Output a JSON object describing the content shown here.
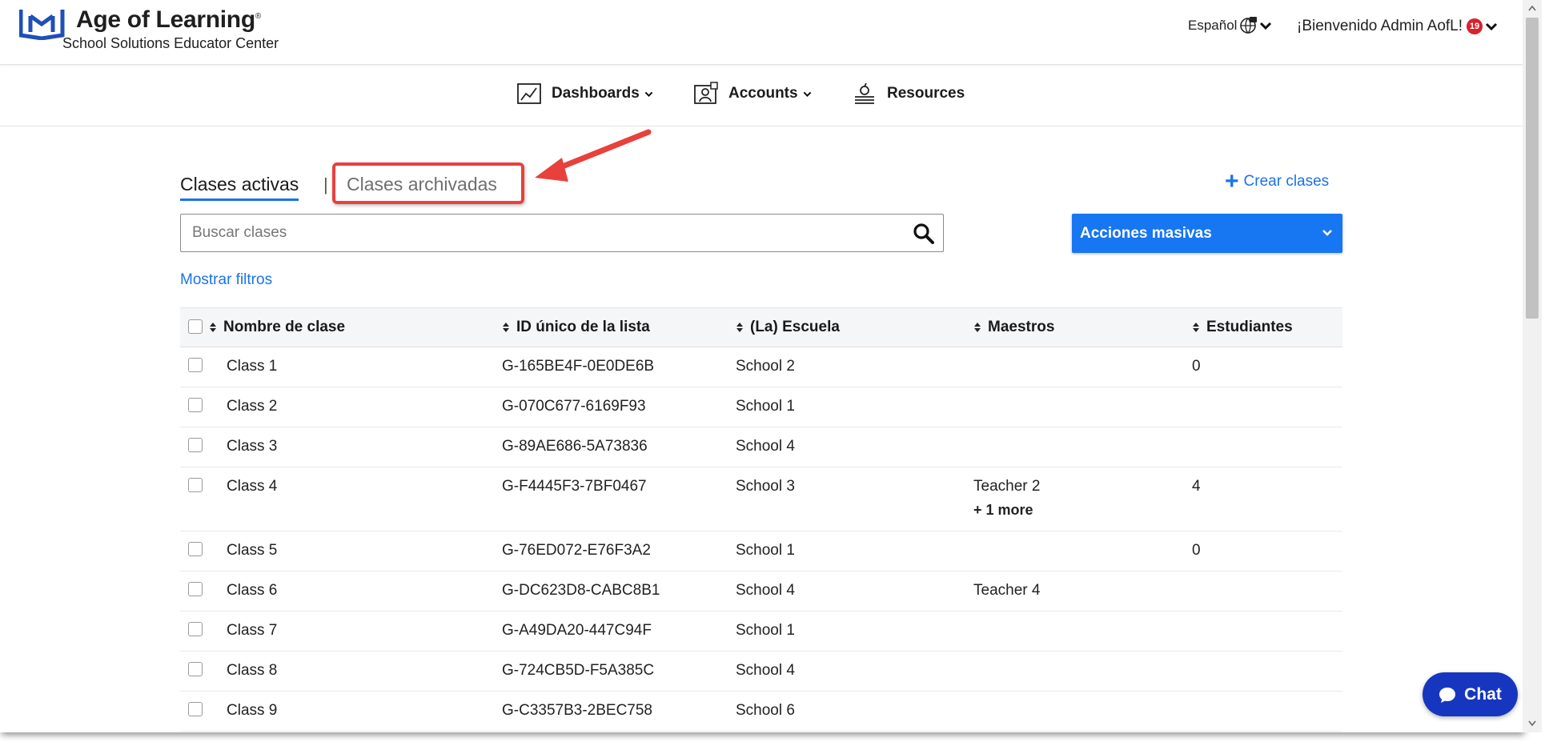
{
  "header": {
    "brand_name": "Age of Learning",
    "brand_reg": "®",
    "brand_subtitle": "School Solutions Educator Center",
    "language": "Español",
    "welcome": "¡Bienvenido Admin AofL!",
    "notification_count": "19"
  },
  "nav": {
    "dashboards": "Dashboards",
    "accounts": "Accounts",
    "resources": "Resources"
  },
  "tabs": {
    "active": "Clases activas",
    "separator": "|",
    "archived": "Clases archivadas"
  },
  "create_classes": "Crear clases",
  "search": {
    "placeholder": "Buscar clases"
  },
  "bulk_actions": "Acciones masivas",
  "show_filters": "Mostrar filtros",
  "table": {
    "headers": {
      "name": "Nombre de clase",
      "id": "ID único de la lista",
      "school": "(La) Escuela",
      "teachers": "Maestros",
      "students": "Estudiantes"
    },
    "rows": [
      {
        "name": "Class 1",
        "id": "G-165BE4F-0E0DE6B",
        "school": "School 2",
        "teacher": "",
        "more": "",
        "students": "0"
      },
      {
        "name": "Class 2",
        "id": "G-070C677-6169F93",
        "school": "School 1",
        "teacher": "",
        "more": "",
        "students": ""
      },
      {
        "name": "Class 3",
        "id": "G-89AE686-5A73836",
        "school": "School 4",
        "teacher": "",
        "more": "",
        "students": ""
      },
      {
        "name": "Class 4",
        "id": "G-F4445F3-7BF0467",
        "school": "School 3",
        "teacher": "Teacher 2",
        "more": "+ 1 more",
        "students": "4"
      },
      {
        "name": "Class 5",
        "id": "G-76ED072-E76F3A2",
        "school": "School 1",
        "teacher": "",
        "more": "",
        "students": "0"
      },
      {
        "name": "Class 6",
        "id": "G-DC623D8-CABC8B1",
        "school": "School 4",
        "teacher": "Teacher 4",
        "more": "",
        "students": ""
      },
      {
        "name": "Class 7",
        "id": "G-A49DA20-447C94F",
        "school": "School 1",
        "teacher": "",
        "more": "",
        "students": ""
      },
      {
        "name": "Class 8",
        "id": "G-724CB5D-F5A385C",
        "school": "School 4",
        "teacher": "",
        "more": "",
        "students": ""
      },
      {
        "name": "Class 9",
        "id": "G-C3357B3-2BEC758",
        "school": "School 6",
        "teacher": "",
        "more": "",
        "students": ""
      }
    ]
  },
  "chat": "Chat",
  "icons": {
    "logo": "age-of-learning-logo-icon",
    "globe": "globe-icon",
    "dashboards": "chart-icon",
    "accounts": "account-icon",
    "resources": "book-apple-icon",
    "search": "search-icon",
    "chat": "chat-bubble-icon"
  },
  "colors": {
    "accent": "#1a73e8",
    "bulk_button": "#1776f2",
    "chat_button": "#1736bf",
    "annotation": "#e8413c",
    "badge": "#d6232d"
  }
}
